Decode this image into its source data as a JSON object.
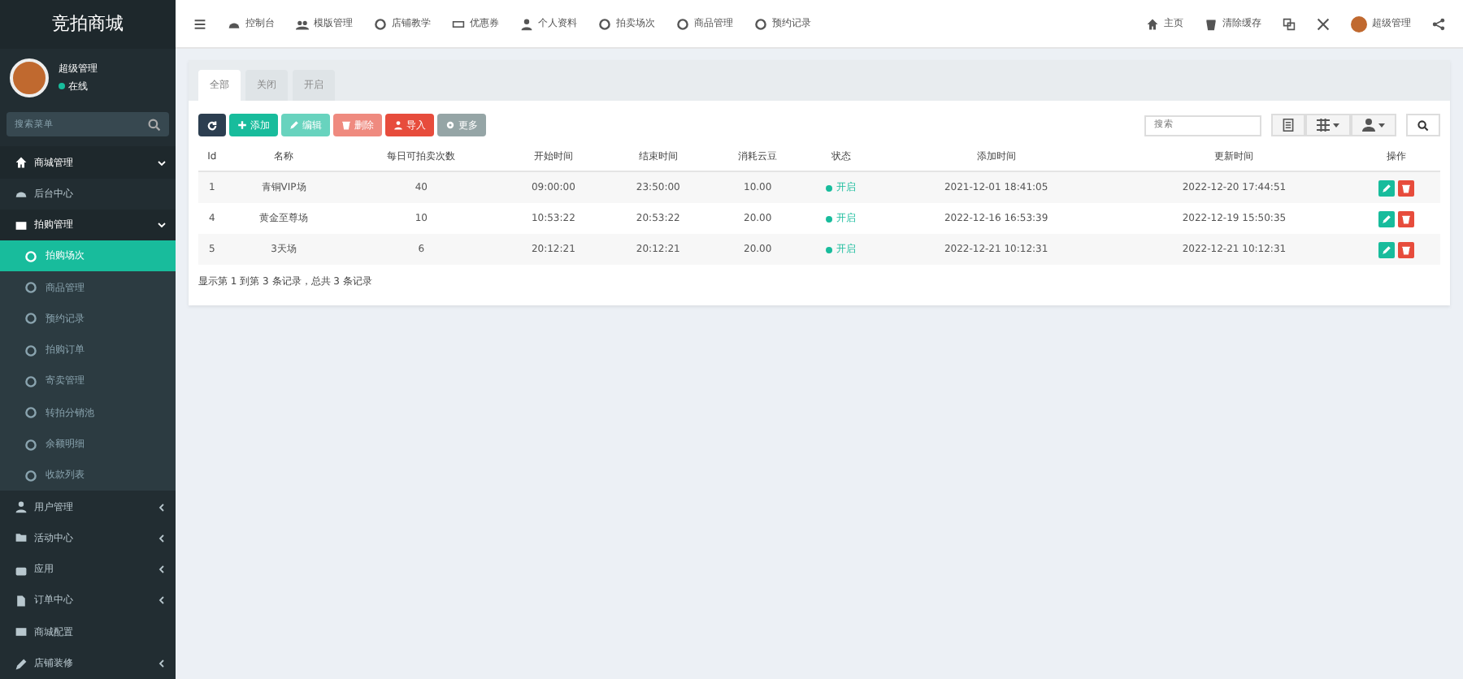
{
  "brand": "竞拍商城",
  "top_nav": [
    "控制台",
    "模版管理",
    "店铺教学",
    "优惠券",
    "个人资料",
    "拍卖场次",
    "商品管理",
    "预约记录"
  ],
  "top_right": [
    "主页",
    "清除缓存",
    "超级管理"
  ],
  "user": {
    "name": "超级管理",
    "status": "在线"
  },
  "sidebar": {
    "search_placeholder": "搜索菜单",
    "items": [
      {
        "label": "商城管理",
        "expanded": true,
        "arrow": true
      },
      {
        "label": "后台中心",
        "expanded": false,
        "arrow": false
      },
      {
        "label": "拍购管理",
        "expanded": true,
        "arrow": true,
        "children": [
          {
            "label": "拍购场次",
            "selected": true
          },
          {
            "label": "商品管理",
            "selected": false
          },
          {
            "label": "预约记录",
            "selected": false
          },
          {
            "label": "拍购订单",
            "selected": false
          },
          {
            "label": "寄卖管理",
            "selected": false
          },
          {
            "label": "转拍分销池",
            "selected": false
          },
          {
            "label": "余额明细",
            "selected": false
          },
          {
            "label": "收款列表",
            "selected": false
          }
        ]
      },
      {
        "label": "用户管理",
        "expanded": false,
        "arrow": true
      },
      {
        "label": "活动中心",
        "expanded": false,
        "arrow": true
      },
      {
        "label": "应用",
        "expanded": false,
        "arrow": true
      },
      {
        "label": "订单中心",
        "expanded": false,
        "arrow": true
      },
      {
        "label": "商城配置",
        "expanded": false,
        "arrow": false
      },
      {
        "label": "店铺装修",
        "expanded": false,
        "arrow": true
      }
    ]
  },
  "tabs": [
    {
      "label": "全部",
      "selected": true
    },
    {
      "label": "关闭",
      "selected": false
    },
    {
      "label": "开启",
      "selected": false
    }
  ],
  "toolbar": [
    {
      "kind": "refresh",
      "disabled": false
    },
    {
      "kind": "add",
      "label": "添加",
      "disabled": false
    },
    {
      "kind": "edit",
      "label": "编辑",
      "disabled": true
    },
    {
      "kind": "delete",
      "label": "删除",
      "disabled": true
    },
    {
      "kind": "import",
      "label": "导入",
      "disabled": false
    },
    {
      "kind": "more",
      "label": "更多",
      "disabled": false
    }
  ],
  "search": {
    "placeholder": "搜索"
  },
  "table": {
    "columns": [
      "Id",
      "名称",
      "每日可拍卖次数",
      "开始时间",
      "结束时间",
      "消耗云豆",
      "状态",
      "添加时间",
      "更新时间",
      "操作"
    ],
    "rows": [
      {
        "cells": [
          "1",
          "青铜VIP场",
          "40",
          "09:00:00",
          "23:50:00",
          "10.00"
        ],
        "status": "开启",
        "on": true,
        "created": "2021-12-01 18:41:05",
        "updated": "2022-12-20 17:44:51"
      },
      {
        "cells": [
          "4",
          "黄金至尊场",
          "10",
          "10:53:22",
          "20:53:22",
          "20.00"
        ],
        "status": "开启",
        "on": true,
        "created": "2022-12-16 16:53:39",
        "updated": "2022-12-19 15:50:35"
      },
      {
        "cells": [
          "5",
          "3天场",
          "6",
          "20:12:21",
          "20:12:21",
          "20.00"
        ],
        "status": "开启",
        "on": true,
        "created": "2022-12-21 10:12:31",
        "updated": "2022-12-21 10:12:31"
      }
    ]
  },
  "pagination": "显示第 1 到第 3 条记录，总共 3 条记录"
}
